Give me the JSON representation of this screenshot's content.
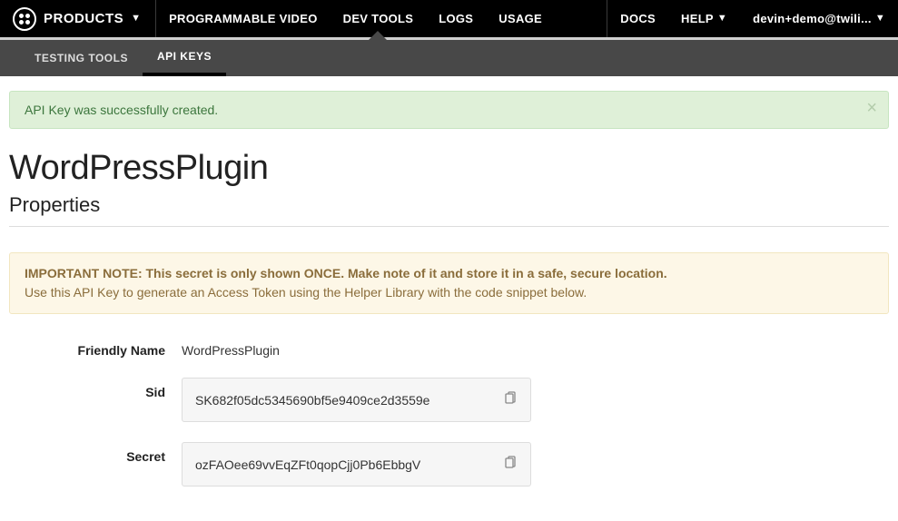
{
  "header": {
    "products_label": "PRODUCTS",
    "main_items": [
      {
        "label": "PROGRAMMABLE VIDEO",
        "active": false
      },
      {
        "label": "DEV TOOLS",
        "active": true
      },
      {
        "label": "LOGS",
        "active": false
      },
      {
        "label": "USAGE",
        "active": false
      }
    ],
    "right_items": [
      {
        "label": "DOCS",
        "caret": false
      },
      {
        "label": "HELP",
        "caret": true
      },
      {
        "label": "devin+demo@twili...",
        "caret": true
      }
    ]
  },
  "subnav": {
    "items": [
      {
        "label": "TESTING TOOLS",
        "active": false
      },
      {
        "label": "API KEYS",
        "active": true
      }
    ]
  },
  "alert_success": {
    "message": "API Key was successfully created."
  },
  "page": {
    "title": "WordPressPlugin",
    "section_title": "Properties"
  },
  "alert_warning": {
    "strong": "IMPORTANT NOTE: This secret is only shown ONCE. Make note of it and store it in a safe, secure location.",
    "text": "Use this API Key to generate an Access Token using the Helper Library with the code snippet below."
  },
  "fields": {
    "friendly_name": {
      "label": "Friendly Name",
      "value": "WordPressPlugin"
    },
    "sid": {
      "label": "Sid",
      "value": "SK682f05dc5345690bf5e9409ce2d3559e"
    },
    "secret": {
      "label": "Secret",
      "value": "ozFAOee69vvEqZFt0qopCjj0Pb6EbbgV"
    }
  }
}
